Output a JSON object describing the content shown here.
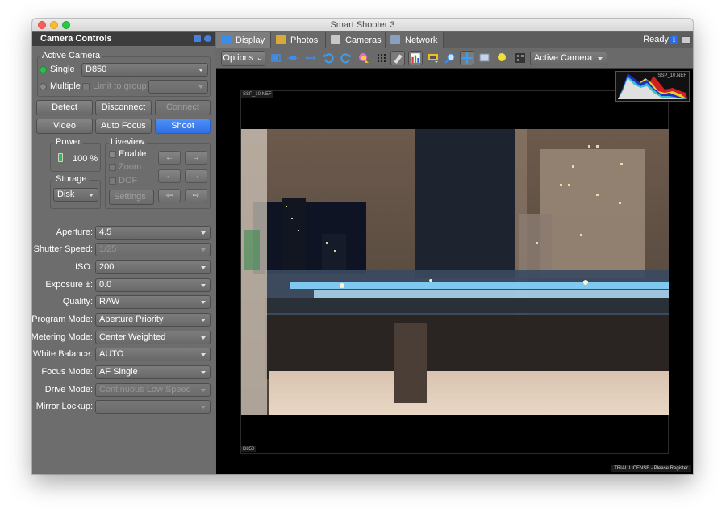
{
  "window": {
    "title": "Smart Shooter 3"
  },
  "left_panel": {
    "title": "Camera Controls",
    "active_camera": {
      "group_label": "Active Camera",
      "single_label": "Single",
      "single_selected": true,
      "camera_value": "D850",
      "multiple_label": "Multiple",
      "limit_to_group_label": "Limit to group:",
      "group_value": ""
    },
    "buttons": {
      "detect": "Detect",
      "disconnect": "Disconnect",
      "connect": "Connect",
      "video": "Video",
      "auto_focus": "Auto Focus",
      "shoot": "Shoot"
    },
    "power": {
      "label": "Power",
      "value": "100 %"
    },
    "storage": {
      "label": "Storage",
      "value": "Disk"
    },
    "liveview": {
      "label": "Liveview",
      "enable": "Enable",
      "zoom": "Zoom",
      "dof": "DOF",
      "settings": "Settings",
      "arrows": [
        "←",
        "→",
        "←",
        "→",
        "⇦",
        "⇨"
      ]
    },
    "fields": [
      {
        "label": "Aperture:",
        "value": "4.5",
        "enabled": true
      },
      {
        "label": "Shutter Speed:",
        "value": "1/25",
        "enabled": false
      },
      {
        "label": "ISO:",
        "value": "200",
        "enabled": true
      },
      {
        "label": "Exposure ±:",
        "value": "0.0",
        "enabled": true
      },
      {
        "label": "Quality:",
        "value": "RAW",
        "enabled": true
      },
      {
        "label": "Program Mode:",
        "value": "Aperture Priority",
        "enabled": true
      },
      {
        "label": "Metering Mode:",
        "value": "Center Weighted",
        "enabled": true
      },
      {
        "label": "White Balance:",
        "value": "AUTO",
        "enabled": true
      },
      {
        "label": "Focus Mode:",
        "value": "AF Single",
        "enabled": true
      },
      {
        "label": "Drive Mode:",
        "value": "Continuous Low Speed",
        "enabled": false
      },
      {
        "label": "Mirror Lockup:",
        "value": "",
        "enabled": false
      }
    ]
  },
  "tabs": [
    {
      "label": "Display",
      "active": true,
      "icon": "monitor-icon"
    },
    {
      "label": "Photos",
      "active": false,
      "icon": "photos-icon"
    },
    {
      "label": "Cameras",
      "active": false,
      "icon": "camera-icon"
    },
    {
      "label": "Network",
      "active": false,
      "icon": "network-icon"
    }
  ],
  "status": {
    "text": "Ready"
  },
  "toolbar": {
    "options_label": "Options",
    "camera_select": "Active Camera",
    "icons": [
      "fit-screen-icon",
      "fit-width-center-icon",
      "fit-width-icon",
      "rotate-left-icon",
      "rotate-right-icon",
      "color-warning-icon",
      "grid-icon",
      "tag-icon",
      "histogram-icon",
      "overlay-icon",
      "zoom-icon",
      "move-icon",
      "crop-view-icon",
      "focus-point-icon",
      "qr-code-icon"
    ]
  },
  "viewer": {
    "filename": "SSP_10.NEF",
    "camera_name": "D850",
    "histogram_label": "SSP_10.NEF",
    "license_notice": "TRIAL LICENSE - Please Register"
  }
}
